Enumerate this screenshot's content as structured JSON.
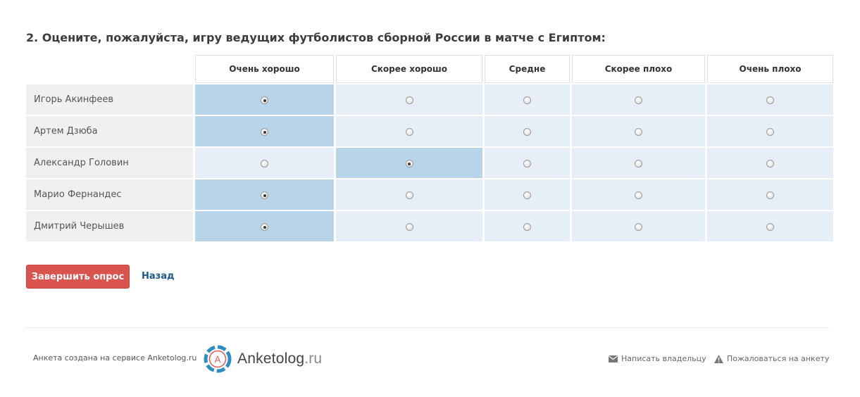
{
  "question": {
    "title": "2. Оцените, пожалуйста, игру ведущих футболистов сборной России в матче с Египтом:"
  },
  "matrix": {
    "columns": [
      "Очень хорошо",
      "Скорее хорошо",
      "Средне",
      "Скорее плохо",
      "Очень плохо"
    ],
    "rows": [
      {
        "label": "Игорь Акинфеев",
        "selected": 0
      },
      {
        "label": "Артем Дзюба",
        "selected": 0
      },
      {
        "label": "Александр Головин",
        "selected": 1
      },
      {
        "label": "Марио Фернандес",
        "selected": 0
      },
      {
        "label": "Дмитрий Черышев",
        "selected": 0
      }
    ]
  },
  "actions": {
    "finish_label": "Завершить опрос",
    "back_label": "Назад"
  },
  "footer": {
    "credit": "Анкета создана на сервисе Anketolog.ru",
    "logo_name": "Anketolog",
    "logo_domain": ".ru",
    "logo_letter": "A",
    "write_owner": "Написать владельцу",
    "report": "Пожаловаться на анкету"
  },
  "colors": {
    "selected_cell": "#b7d4e8",
    "cell": "#e6eef7",
    "label_cell": "#f0f0f0",
    "finish_button": "#d9534f",
    "link": "#1c5a8c",
    "logo_accent": "#2f8dc4"
  }
}
